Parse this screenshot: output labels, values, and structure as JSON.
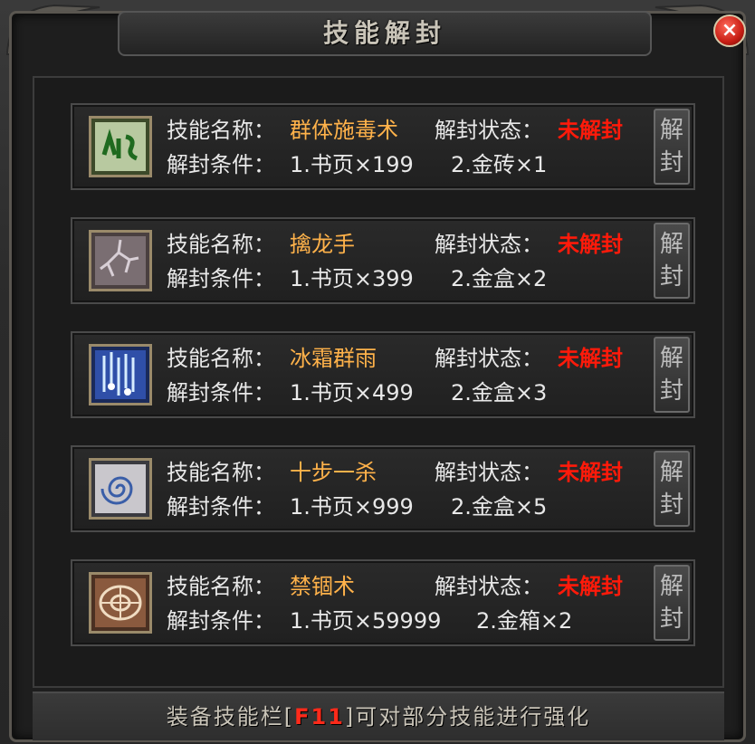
{
  "window": {
    "title": "技能解封",
    "close_label": "×"
  },
  "labels": {
    "skill_name": "技能名称：",
    "unlock_status": "解封状态：",
    "unlock_condition": "解封条件："
  },
  "unlock_button": {
    "line1": "解",
    "line2": "封"
  },
  "skills": [
    {
      "name": "群体施毒术",
      "status": "未解封",
      "cond1": "1.书页×199",
      "cond2": "2.金砖×1",
      "icon": "poison-icon"
    },
    {
      "name": "擒龙手",
      "status": "未解封",
      "cond1": "1.书页×399",
      "cond2": "2.金盒×2",
      "icon": "dragon-grab-icon"
    },
    {
      "name": "冰霜群雨",
      "status": "未解封",
      "cond1": "1.书页×499",
      "cond2": "2.金盒×3",
      "icon": "ice-rain-icon"
    },
    {
      "name": "十步一杀",
      "status": "未解封",
      "cond1": "1.书页×999",
      "cond2": "2.金盒×5",
      "icon": "swirl-icon"
    },
    {
      "name": "禁锢术",
      "status": "未解封",
      "cond1": "1.书页×59999",
      "cond2": "2.金箱×2",
      "icon": "seal-circle-icon"
    }
  ],
  "footer": {
    "prefix": "装备技能栏[",
    "key": "F11",
    "suffix": "]可对部分技能进行强化"
  },
  "colors": {
    "skill_name": "#ffb24a",
    "status_locked": "#ff1a0a",
    "text": "#e8e8e8"
  }
}
